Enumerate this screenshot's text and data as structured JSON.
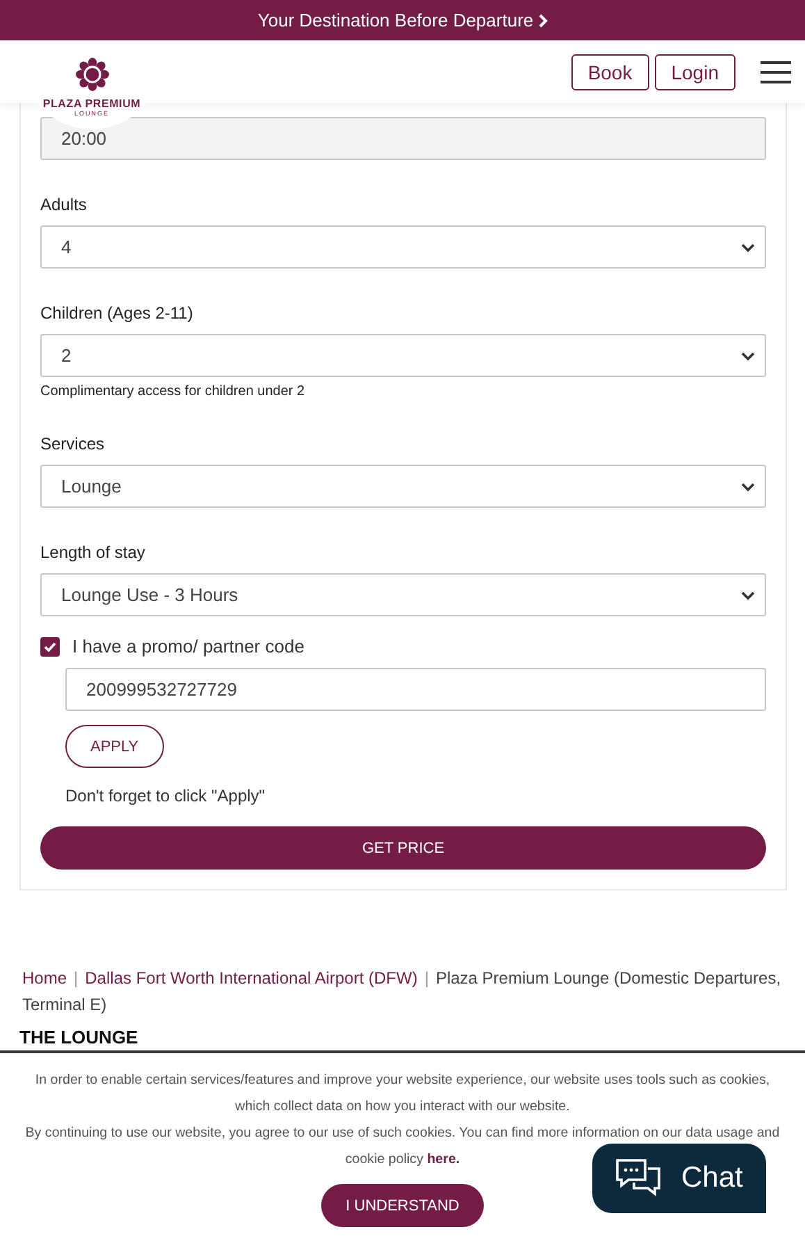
{
  "announcement": {
    "text": "Your Destination Before Departure"
  },
  "header": {
    "logo": {
      "name": "PLAZA PREMIUM",
      "sub": "LOUNGE"
    },
    "buttons": [
      "Book",
      "Login"
    ]
  },
  "form": {
    "fields": [
      {
        "kind": "input",
        "value": "20:00"
      },
      {
        "kind": "select",
        "label": "Adults",
        "value": "4"
      },
      {
        "kind": "select",
        "label": "Children (Ages 2-11)",
        "value": "2",
        "hint": "Complimentary access for children under 2"
      },
      {
        "kind": "select",
        "label": "Services",
        "value": "Lounge"
      },
      {
        "kind": "select",
        "label": "Length of stay",
        "value": "Lounge Use - 3 Hours"
      }
    ],
    "promo": {
      "label": "I have a promo/ partner code",
      "checked": true,
      "code": "200999532727729",
      "apply": "APPLY",
      "note": "Don't forget to click \"Apply\""
    },
    "submit": "GET PRICE"
  },
  "breadcrumb": {
    "separator": "|",
    "items": [
      {
        "label": "Home",
        "kind": "link"
      },
      {
        "label": "Dallas Fort Worth International Airport (DFW)",
        "kind": "link"
      },
      {
        "label": "Plaza Premium Lounge (Domestic Departures, Terminal E)",
        "kind": "current"
      }
    ]
  },
  "section_title": "THE LOUNGE",
  "cookie": {
    "paragraphs": [
      "In order to enable certain services/features and improve your website experience, our website uses tools such as cookies, which collect data on how you interact with our website.",
      "By continuing to use our website, you agree to our use of such cookies. You can find more information on our data usage and cookie policy"
    ],
    "link": "here.",
    "button": "I UNDERSTAND"
  },
  "chat": {
    "label": "Chat"
  }
}
